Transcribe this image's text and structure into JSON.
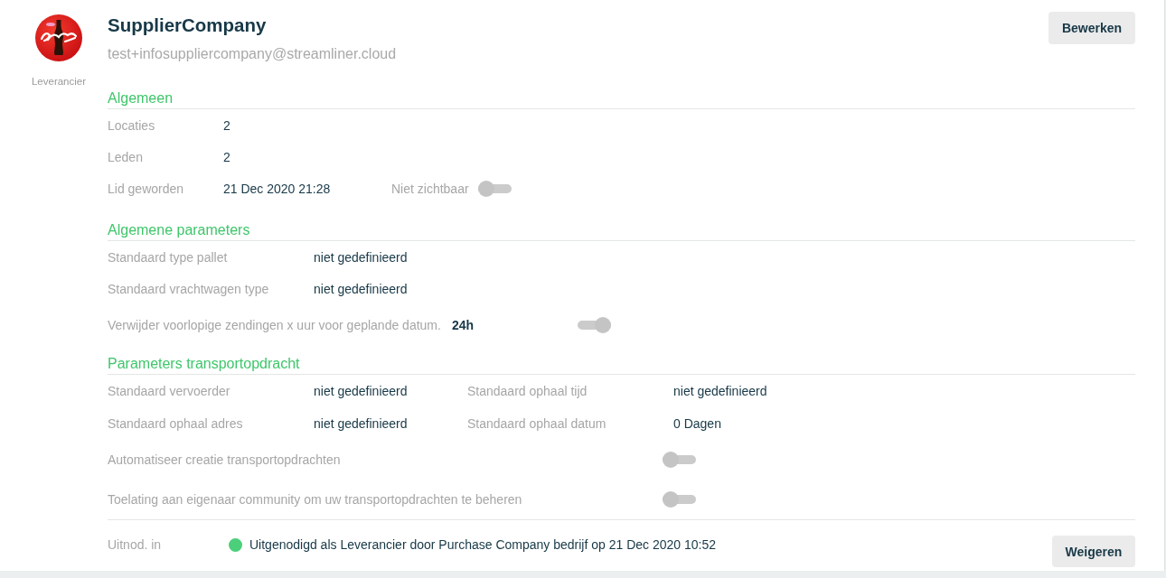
{
  "profile": {
    "name": "SupplierCompany",
    "email": "test+infosuppliercompany@streamliner.cloud",
    "role": "Leverancier",
    "edit_button": "Bewerken"
  },
  "sections": [
    {
      "title": "Algemeen",
      "rows": [
        {
          "kind": "field",
          "label": "Locaties",
          "value": "2"
        },
        {
          "kind": "field",
          "label": "Leden",
          "value": "2"
        },
        {
          "kind": "field",
          "label": "Lid geworden",
          "value": "21 Dec 2020 21:28",
          "toggle": {
            "label": "Niet zichtbaar",
            "on": false,
            "disabled": true
          }
        }
      ]
    },
    {
      "title": "Algemene parameters",
      "rows": [
        {
          "kind": "field",
          "label": "Standaard type pallet",
          "value": "niet gedefinieerd"
        },
        {
          "kind": "field",
          "label": "Standaard vrachtwagen type",
          "value": "niet gedefinieerd"
        },
        {
          "kind": "setting",
          "label": "Verwijder voorlopige zendingen x uur voor geplande datum.",
          "value": "24h",
          "toggle": {
            "on": true,
            "disabled": true
          }
        }
      ]
    },
    {
      "title": "Parameters transportopdracht",
      "rows": [
        {
          "kind": "pair",
          "fields": [
            {
              "label": "Standaard vervoerder",
              "value": "niet gedefinieerd"
            },
            {
              "label": "Standaard ophaal tijd",
              "value": "niet gedefinieerd"
            }
          ]
        },
        {
          "kind": "pair",
          "fields": [
            {
              "label": "Standaard ophaal adres",
              "value": "niet gedefinieerd"
            },
            {
              "label": "Standaard ophaal datum",
              "value": "0 Dagen"
            }
          ]
        },
        {
          "kind": "switch",
          "label": "Automatiseer creatie transportopdrachten",
          "toggle": {
            "on": false,
            "disabled": true
          }
        },
        {
          "kind": "switch",
          "label": "Toelating aan eigenaar community om uw transportopdrachten te beheren",
          "toggle": {
            "on": false,
            "disabled": true
          }
        }
      ]
    }
  ],
  "invitation": {
    "label": "Uitnod. in",
    "text": "Uitgenodigd als Leverancier door Purchase Company bedrijf op 21 Dec 2020 10:52",
    "decline_button": "Weigeren"
  }
}
